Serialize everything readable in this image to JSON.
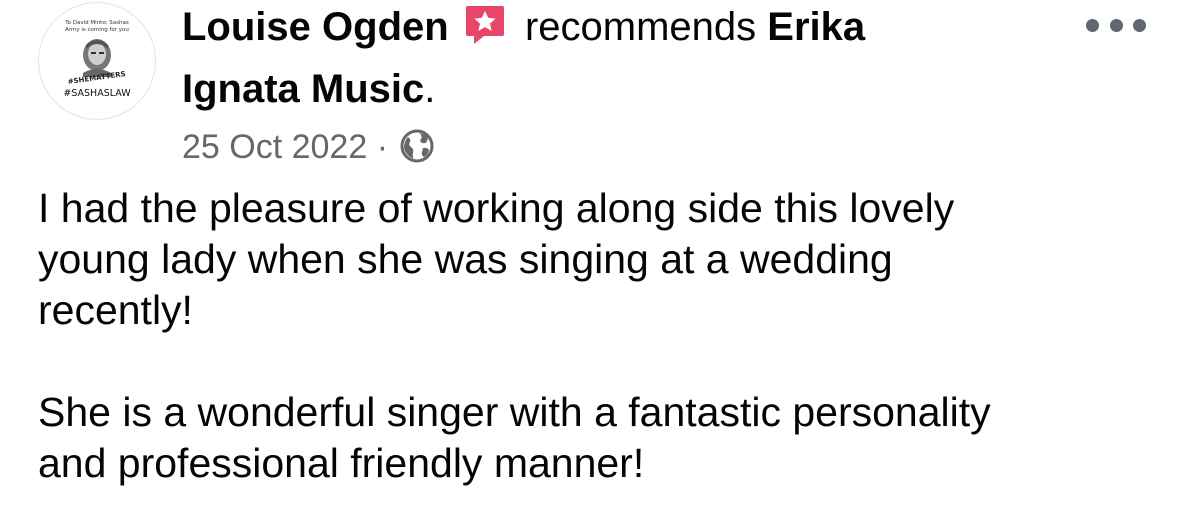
{
  "post": {
    "author": "Louise Ogden",
    "action": "recommends",
    "page_name_part1": "Erika",
    "page_name_part2": "Ignata Music",
    "page_name_suffix": ".",
    "date": "25 Oct 2022",
    "separator": "·",
    "privacy_icon": "globe-icon",
    "recommend_icon": "star-speech-bubble-icon",
    "menu_icon": "more-options-icon",
    "accent_color": "#e8456b",
    "body": [
      "I had the pleasure of working along side this lovely",
      "young lady when she was singing at a wedding",
      "recently!",
      "",
      "She is a wonderful singer with a fantastic personality",
      "and professional friendly manner!"
    ]
  },
  "avatar": {
    "top_text_1": "To David Minto; Sashas",
    "top_text_2": "Army is coming for you",
    "curved_text": "#SHEMATTERS",
    "bottom_text": "#SASHASLAW"
  }
}
